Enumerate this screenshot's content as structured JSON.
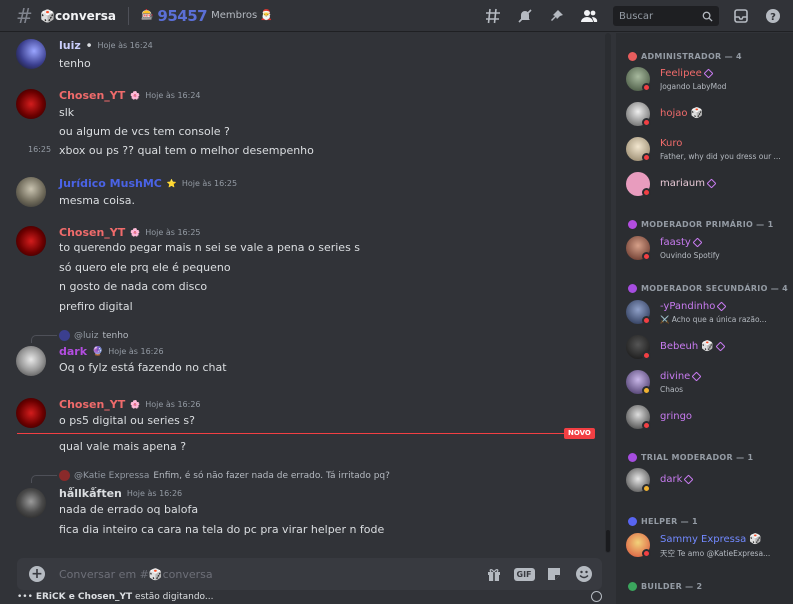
{
  "header": {
    "channel_name": "🎲conversa",
    "topic_prefix": "🎰",
    "topic_count": "95457",
    "topic_suffix": "Membros 🎅",
    "search_placeholder": "Buscar"
  },
  "messages": [
    {
      "author": "luiz",
      "author_color": "#c9cdfb",
      "badge": "⚫",
      "timestamp": "Hoje às 16:24",
      "lines": [
        "tenho"
      ]
    },
    {
      "author": "Chosen_YT",
      "author_color": "#f06b6b",
      "badge": "🌸",
      "timestamp": "Hoje às 16:24",
      "lines": [
        "slk",
        "ou algum de vcs tem console ?",
        "xbox ou ps ?? qual tem o melhor desempenho"
      ],
      "hover_time": "16:25"
    },
    {
      "author": "Jurídico MushMC",
      "author_color": "#4a63e6",
      "badge": "⭐",
      "timestamp": "Hoje às 16:25",
      "lines": [
        "mesma coisa."
      ]
    },
    {
      "author": "Chosen_YT",
      "author_color": "#f06b6b",
      "badge": "🌸",
      "timestamp": "Hoje às 16:25",
      "lines": [
        "to querendo pegar mais n sei se vale a pena o series s",
        "só quero ele prq ele é pequeno",
        "n gosto de nada com disco",
        "prefiro digital"
      ]
    },
    {
      "reply_to": "@luiz",
      "reply_text": "tenho",
      "author": "dark",
      "author_color": "#b34de0",
      "badge": "🔮",
      "timestamp": "Hoje às 16:26",
      "lines": [
        "Oq o fylz está fazendo no chat"
      ]
    },
    {
      "author": "Chosen_YT",
      "author_color": "#f06b6b",
      "badge": "🌸",
      "timestamp": "Hoje às 16:26",
      "lines": [
        "o ps5 digital ou series s?",
        "qual vale mais apena ?"
      ]
    },
    {
      "reply_to": "@Katie Expressa",
      "reply_text": "Enfim, é só não fazer nada de errado. Tá irritado pq?",
      "author": "hǻllkǻften",
      "author_color": "#dbdee1",
      "badge": "",
      "timestamp": "Hoje às 16:26",
      "lines": [
        "nada de errado oq balofa",
        "fica dia inteiro ca cara na tela do pc pra virar helper n fode"
      ]
    }
  ],
  "new_label": "NOVO",
  "composer": {
    "placeholder": "Conversar em #🎲conversa",
    "gif_label": "GIF"
  },
  "typing": {
    "users": "ERiCK e Chosen_YT",
    "suffix": "estão digitando..."
  },
  "members": {
    "groups": [
      {
        "title": "ADMINISTRADOR — 4",
        "color": "#e85d5d",
        "members": [
          {
            "name": "Feelipee",
            "color": "#f06b6b",
            "sub": "Jogando LabyMod",
            "gem": true
          },
          {
            "name": "hojao 🎲",
            "color": "#f06b6b",
            "sub": ""
          },
          {
            "name": "Kuro",
            "color": "#f06b6b",
            "sub": "Father, why did you dress our ..."
          },
          {
            "name": "mariaum",
            "color": "#e8c9d6",
            "sub": "",
            "gem": true
          }
        ]
      },
      {
        "title": "MODERADOR PRIMÁRIO — 1",
        "color": "#b34de0",
        "members": [
          {
            "name": "faasty",
            "color": "#c87bf0",
            "sub": "Ouvindo Spotify",
            "gem": true
          }
        ]
      },
      {
        "title": "MODERADOR SECUNDÁRIO — 4",
        "color": "#a64de0",
        "members": [
          {
            "name": "-yPandinho",
            "color": "#c87bf0",
            "sub": "⚔️ Acho que a única razão...",
            "gem": true
          },
          {
            "name": "Bebeuh 🎲",
            "color": "#c87bf0",
            "sub": "",
            "gem": true
          },
          {
            "name": "divine",
            "color": "#c87bf0",
            "sub": "Chaos",
            "gem": true
          },
          {
            "name": "gringo",
            "color": "#c87bf0",
            "sub": ""
          }
        ]
      },
      {
        "title": "TRIAL MODERADOR — 1",
        "color": "#a64de0",
        "members": [
          {
            "name": "dark",
            "color": "#c87bf0",
            "sub": "",
            "gem": true
          }
        ]
      },
      {
        "title": "HELPER — 1",
        "color": "#5865f2",
        "members": [
          {
            "name": "Sammy Expressa 🎲",
            "color": "#7289ff",
            "sub": "天空 Te amo @KatieExpresa..."
          }
        ]
      },
      {
        "title": "BUILDER — 2",
        "color": "#3ba55d",
        "members": []
      }
    ]
  }
}
